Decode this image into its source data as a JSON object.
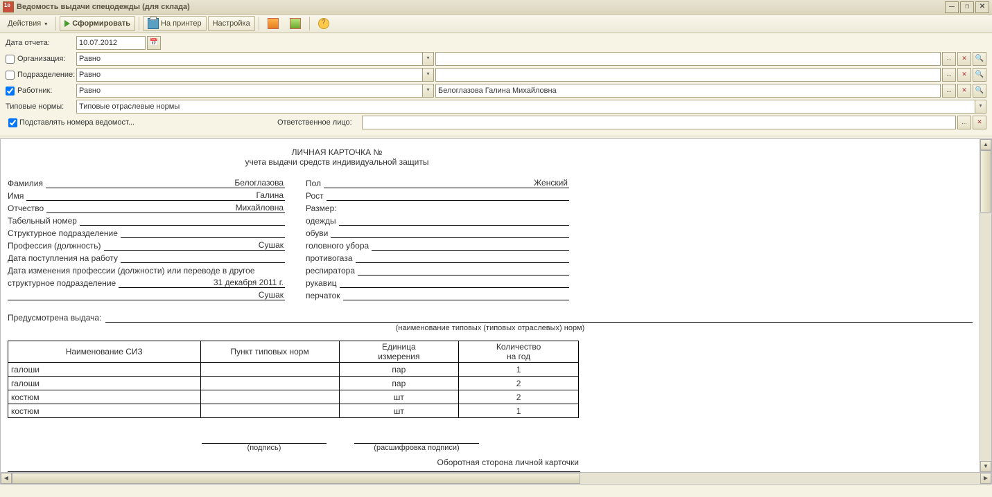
{
  "title": "Ведомость выдачи спецодежды (для склада)",
  "toolbar": {
    "actions": "Действия",
    "form": "Сформировать",
    "print": "На принтер",
    "settings": "Настройка"
  },
  "filters": {
    "date_lbl": "Дата отчета:",
    "date_val": "10.07.2012",
    "org_lbl": "Организация:",
    "dep_lbl": "Подразделение:",
    "emp_lbl": "Работник:",
    "cmp_equal": "Равно",
    "emp_val": "Белоглазова Галина Михайловна",
    "norms_lbl": "Типовые нормы:",
    "norms_val": "Типовые отраслевые нормы",
    "subst_lbl": "Подставлять номера ведомост...",
    "resp_lbl": "Ответственное лицо:"
  },
  "card": {
    "h1": "ЛИЧНАЯ КАРТОЧКА №",
    "h2": "учета выдачи средств индивидуальной защиты",
    "left": {
      "surname_l": "Фамилия",
      "surname_v": "Белоглазова",
      "name_l": "Имя",
      "name_v": "Галина",
      "patr_l": "Отчество",
      "patr_v": "Михайловна",
      "tab_l": "Табельный номер",
      "dept_l": "Структурное подразделение",
      "prof_l": "Профессия (должность)",
      "prof_v": "Сушак",
      "hire_l": "Дата поступления на работу",
      "chg1": "Дата изменения профессии (должности) или переводе в другое",
      "chg2": "структурное подразделение",
      "chg2_v": "31 декабря 2011 г.",
      "chg3_v": "Сушак"
    },
    "right": {
      "sex_l": "Пол",
      "sex_v": "Женский",
      "height_l": "Рост",
      "size_l": "Размер:",
      "clothes_l": "одежды",
      "shoes_l": "обуви",
      "head_l": "головного убора",
      "gas_l": "противогаза",
      "resp_l": "респиратора",
      "mitt_l": "рукавиц",
      "gloves_l": "перчаток"
    },
    "issue_l": "Предусмотрена выдача:",
    "issue_sub": "(наименование типовых (типовых отраслевых) норм)",
    "table": {
      "h1": "Наименование СИЗ",
      "h2": "Пункт типовых норм",
      "h3a": "Единица",
      "h3b": "измерения",
      "h4a": "Количество",
      "h4b": "на год",
      "rows": [
        {
          "name": "галоши",
          "unit": "пар",
          "qty": "1"
        },
        {
          "name": "галоши",
          "unit": "пар",
          "qty": "2"
        },
        {
          "name": "костюм",
          "unit": "шт",
          "qty": "2"
        },
        {
          "name": "костюм",
          "unit": "шт",
          "qty": "1"
        }
      ]
    },
    "sign1": "(подпись)",
    "sign2": "(расшифровка подписи)",
    "flip": "Оборотная сторона личной карточки"
  }
}
